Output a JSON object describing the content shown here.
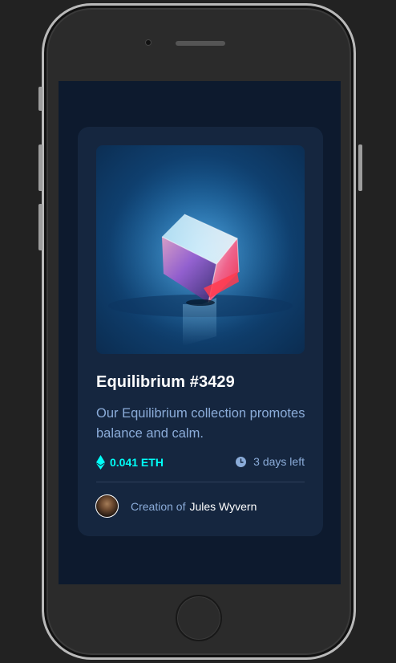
{
  "card": {
    "title": "Equilibrium #3429",
    "description": "Our Equilibrium collection promotes balance and calm.",
    "price": "0.041 ETH",
    "time_left": "3 days left",
    "creator_prefix": "Creation of",
    "creator_name": "Jules Wyvern"
  },
  "icons": {
    "price": "ethereum-icon",
    "time": "clock-icon"
  },
  "colors": {
    "page_bg": "#0d1a2e",
    "card_bg": "#15263f",
    "accent_cyan": "#00fff8",
    "soft_blue": "#8bacd9",
    "white": "#ffffff"
  }
}
